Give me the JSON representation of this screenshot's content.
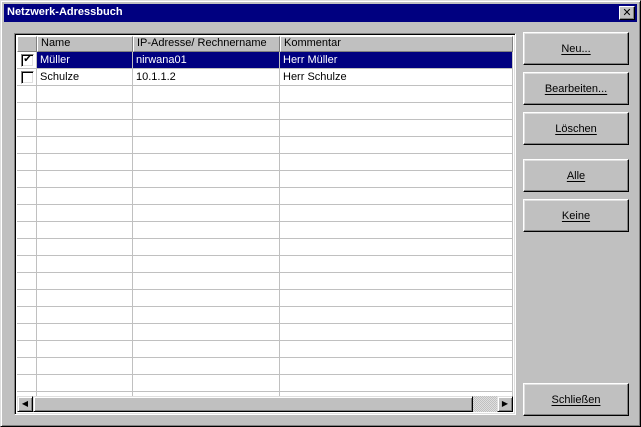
{
  "window": {
    "title": "Netzwerk-Adressbuch",
    "close_glyph": "✕"
  },
  "columns": [
    "",
    "Name",
    "IP-Adresse/ Rechnername",
    "Kommentar"
  ],
  "entries": [
    {
      "checked": true,
      "checkmark": "✔",
      "name": "Müller",
      "address": "nirwana01",
      "comment": "Herr Müller",
      "selected": true
    },
    {
      "checked": false,
      "checkmark": "",
      "name": "Schulze",
      "address": "10.1.1.2",
      "comment": "Herr Schulze",
      "selected": false
    }
  ],
  "empty_rows": 19,
  "scrollbar": {
    "left_arrow": "◀",
    "right_arrow": "▶"
  },
  "buttons": {
    "new": "Neu...",
    "edit": "Bearbeiten...",
    "delete": "Löschen",
    "all": "Alle",
    "none": "Keine",
    "close": "Schließen"
  },
  "colors": {
    "selection": "#000080",
    "titlebar": "#000080",
    "face": "#c0c0c0"
  }
}
